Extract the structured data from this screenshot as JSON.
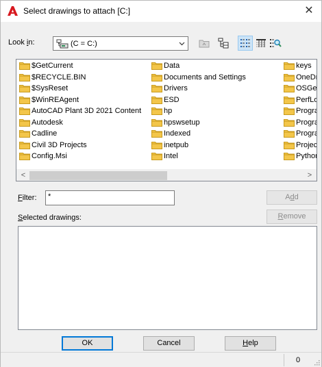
{
  "window": {
    "title": "Select drawings to attach [C:]",
    "app_icon": "autocad-a-icon",
    "close_glyph": "✕"
  },
  "lookin": {
    "label_pre": "Look ",
    "label_u": "i",
    "label_post": "n:",
    "value": "(C = C:)",
    "drive_icon": "network-drive-icon"
  },
  "toolbar": {
    "icons": [
      "up-folder-icon",
      "tree-view-icon",
      "list-view-icon",
      "details-view-icon",
      "preview-search-icon"
    ]
  },
  "files": {
    "col1": [
      "$GetCurrent",
      "$RECYCLE.BIN",
      "$SysReset",
      "$WinREAgent",
      "AutoCAD Plant 3D 2021 Content",
      "Autodesk",
      "Cadline",
      "Civil 3D Projects",
      "Config.Msi"
    ],
    "col2": [
      "Data",
      "Documents and Settings",
      "Drivers",
      "ESD",
      "hp",
      "hpswsetup",
      "Indexed",
      "inetpub",
      "Intel"
    ],
    "col3": [
      "keys",
      "OneDr",
      "OSGe",
      "PerfLo",
      "Progra",
      "Progra",
      "Progra",
      "Projec",
      "Python"
    ],
    "scroll_left": "<",
    "scroll_right": ">"
  },
  "filter": {
    "label_u": "F",
    "label_rest": "ilter:",
    "value": "*"
  },
  "buttons": {
    "add_pre": "A",
    "add_u": "d",
    "add_post": "d",
    "remove_u": "R",
    "remove_rest": "emove",
    "ok": "OK",
    "cancel": "Cancel",
    "help_u": "H",
    "help_rest": "elp"
  },
  "selected": {
    "label_u": "S",
    "label_rest": "elected drawings:"
  },
  "status": {
    "count": "0"
  },
  "colors": {
    "folder": "#f3c64a",
    "accent": "#0078d7",
    "autocad_red": "#d71920"
  }
}
